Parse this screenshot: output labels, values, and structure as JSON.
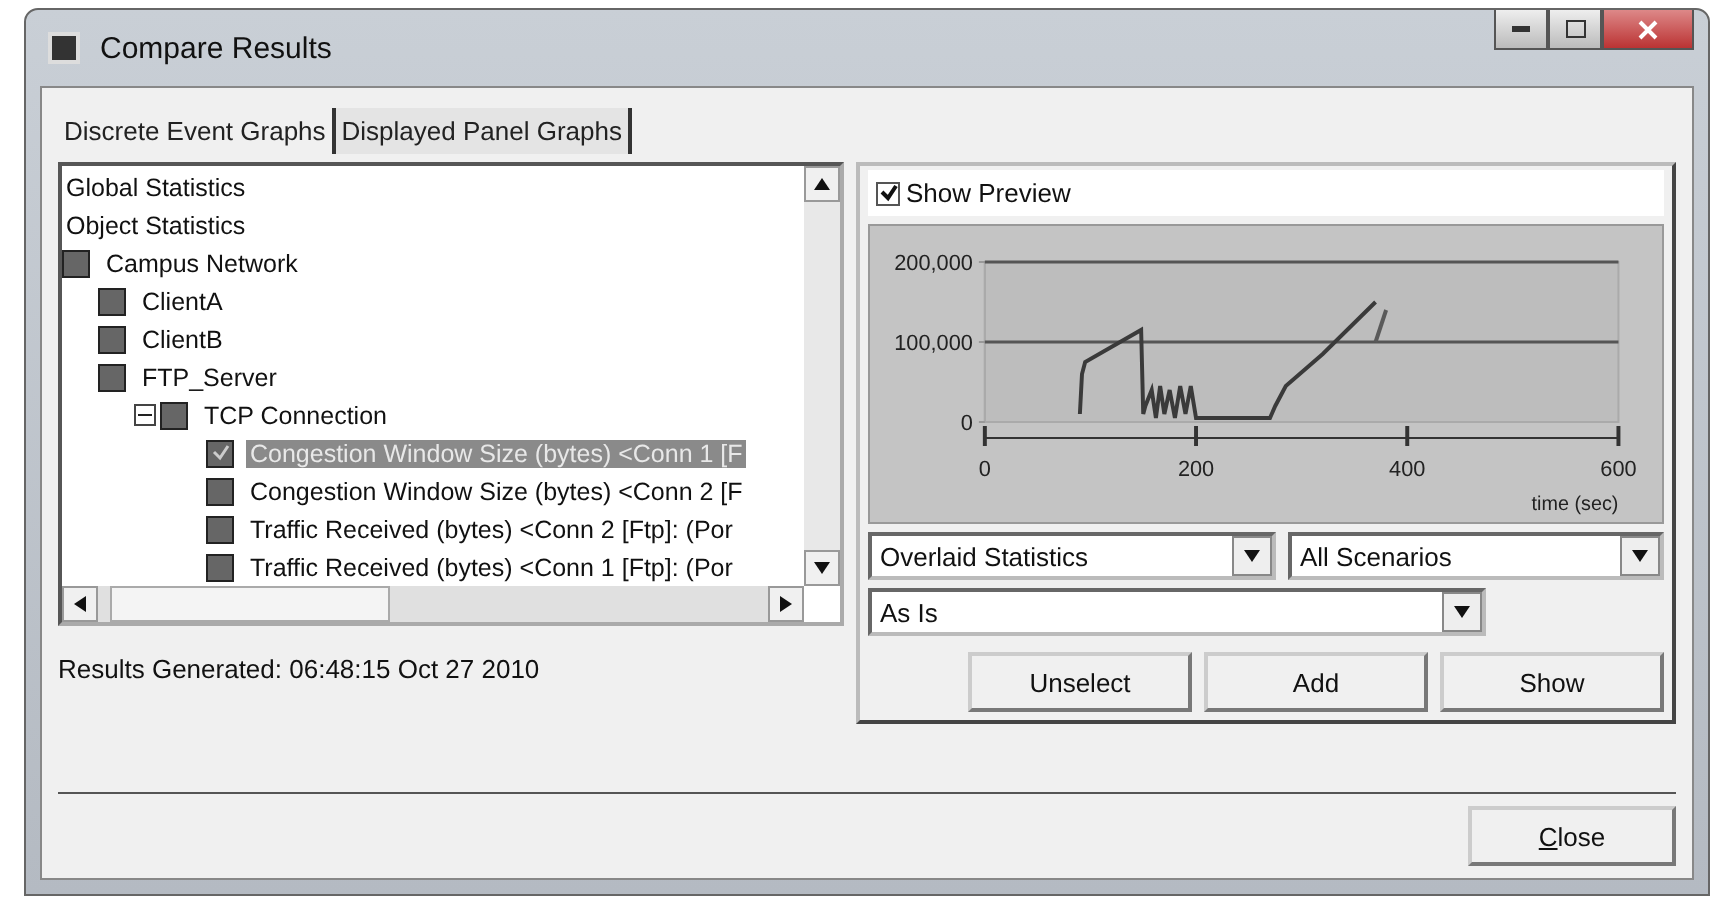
{
  "window": {
    "title": "Compare Results"
  },
  "tabs": [
    {
      "label": "Discrete Event Graphs",
      "selected": true
    },
    {
      "label": "Displayed Panel Graphs",
      "selected": false
    }
  ],
  "tree": [
    {
      "label": "Global Statistics",
      "kind": "text"
    },
    {
      "label": "Object Statistics",
      "kind": "text"
    },
    {
      "label": "Campus Network",
      "kind": "node",
      "children": [
        {
          "label": "ClientA",
          "kind": "node"
        },
        {
          "label": "ClientB",
          "kind": "node"
        },
        {
          "label": "FTP_Server",
          "kind": "node",
          "children": [
            {
              "label": "TCP Connection",
              "kind": "node",
              "expanded": true,
              "children": [
                {
                  "label": "Congestion Window Size (bytes) <Conn 1 [F",
                  "kind": "leaf",
                  "selected": true,
                  "checked": true
                },
                {
                  "label": "Congestion Window Size (bytes) <Conn 2 [F",
                  "kind": "leaf",
                  "selected": false,
                  "checked": false
                },
                {
                  "label": "Traffic Received (bytes) <Conn 2 [Ftp]: (Por",
                  "kind": "leaf",
                  "selected": false,
                  "checked": false
                },
                {
                  "label": "Traffic Received (bytes) <Conn 1 [Ftp]: (Por",
                  "kind": "leaf",
                  "selected": false,
                  "checked": false
                }
              ]
            }
          ]
        }
      ]
    }
  ],
  "status": "Results Generated: 06:48:15 Oct 27 2010",
  "preview": {
    "label": "Show Preview",
    "checked": true,
    "chart_data": {
      "type": "line",
      "xlabel": "time (sec)",
      "xlim": [
        0,
        600
      ],
      "ylim": [
        0,
        200000
      ],
      "xticks": [
        0,
        200,
        400,
        600
      ],
      "yticks": [
        {
          "value": 0,
          "label": "0"
        },
        {
          "value": 100000,
          "label": "100,000"
        },
        {
          "value": 200000,
          "label": "200,000"
        }
      ],
      "x": [
        90,
        92,
        95,
        148,
        150,
        152,
        158,
        162,
        166,
        170,
        175,
        180,
        185,
        190,
        195,
        200,
        210,
        270,
        275,
        285,
        320,
        370,
        380
      ],
      "series": [
        {
          "color": "#3a3a3a",
          "values": [
            10000,
            60000,
            75000,
            115000,
            10000,
            20000,
            40000,
            5000,
            45000,
            10000,
            40000,
            5000,
            45000,
            10000,
            45000,
            5000,
            5000,
            5000,
            20000,
            45000,
            85000,
            150000,
            null
          ]
        },
        {
          "color": "#5a5a5a",
          "values": [
            null,
            null,
            null,
            null,
            null,
            null,
            null,
            null,
            null,
            null,
            null,
            null,
            null,
            null,
            null,
            null,
            null,
            null,
            null,
            null,
            null,
            100000,
            140000
          ]
        }
      ]
    }
  },
  "selects": [
    {
      "value": "Overlaid Statistics"
    },
    {
      "value": "All Scenarios"
    },
    {
      "value": "As Is"
    }
  ],
  "buttons": [
    {
      "label": "Unselect"
    },
    {
      "label": "Add"
    },
    {
      "label": "Show"
    }
  ],
  "close": {
    "label": "Close"
  }
}
